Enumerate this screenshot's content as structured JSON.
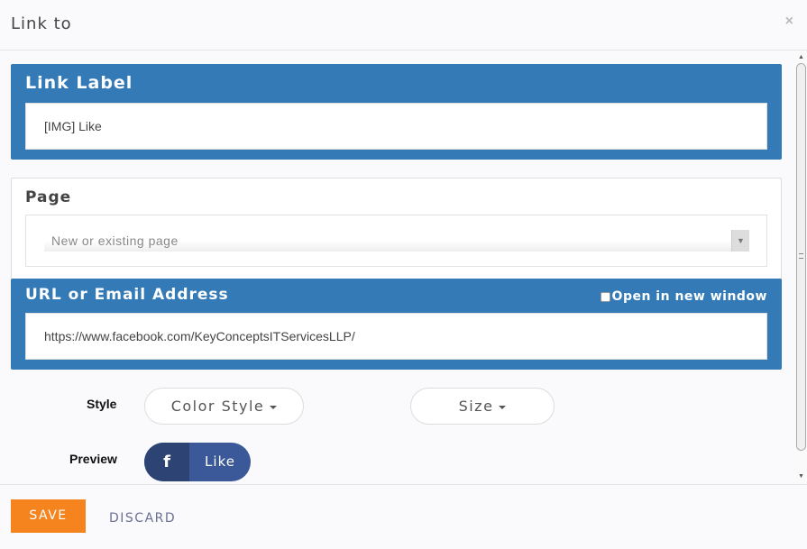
{
  "dialog": {
    "title": "Link to",
    "close_icon": "×"
  },
  "link_label": {
    "title": "Link Label",
    "value": "[IMG] Like"
  },
  "page": {
    "title": "Page",
    "placeholder": "New or existing page"
  },
  "url": {
    "title": "URL or Email Address",
    "open_new_window_label": "Open in new window",
    "open_new_window_checked": false,
    "value": "https://www.facebook.com/KeyConceptsITServicesLLP/"
  },
  "style": {
    "label": "Style",
    "color_style_button": "Color Style",
    "size_button": "Size"
  },
  "preview": {
    "label": "Preview",
    "fb_icon": "f",
    "button_text": "Like"
  },
  "footer": {
    "save_label": "SAVE",
    "discard_label": "DISCARD"
  },
  "colors": {
    "accent_blue": "#337ab7",
    "save_orange": "#f5841f",
    "facebook_blue": "#3b5998",
    "facebook_dark": "#2d4373",
    "discard_text": "#6b6f95"
  }
}
